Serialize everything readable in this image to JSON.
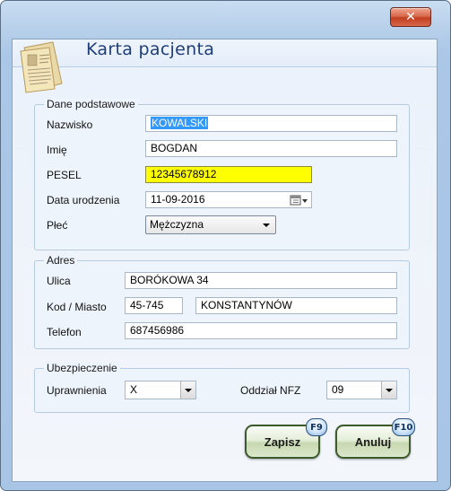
{
  "window": {
    "close_glyph": "✕"
  },
  "header": {
    "title": "Karta pacjenta",
    "icon": "patient-card-icon"
  },
  "personal": {
    "legend": "Dane podstawowe",
    "surname_label": "Nazwisko",
    "surname_value": "KOWALSKI",
    "first_name_label": "Imię",
    "first_name_value": "BOGDAN",
    "pesel_label": "PESEL",
    "pesel_value": "12345678912",
    "birth_label": "Data urodzenia",
    "birth_value": "11-09-2016",
    "sex_label": "Płeć",
    "sex_value": "Mężczyzna"
  },
  "address": {
    "legend": "Adres",
    "street_label": "Ulica",
    "street_value": "BORÓKOWA 34",
    "city_label": "Kod / Miasto",
    "postal_value": "45-745",
    "city_value": "KONSTANTYNÓW",
    "phone_label": "Telefon",
    "phone_value": "687456986"
  },
  "insurance": {
    "legend": "Ubezpieczenie",
    "rights_label": "Uprawnienia",
    "rights_value": "X",
    "nfz_label": "Oddział NFZ",
    "nfz_value": "09"
  },
  "actions": {
    "save_label": "Zapisz",
    "save_key": "F9",
    "cancel_label": "Anuluj",
    "cancel_key": "F10"
  },
  "colors": {
    "pesel_bg": "#ffff00",
    "title": "#1f3d7a",
    "selection": "#3399ff"
  }
}
